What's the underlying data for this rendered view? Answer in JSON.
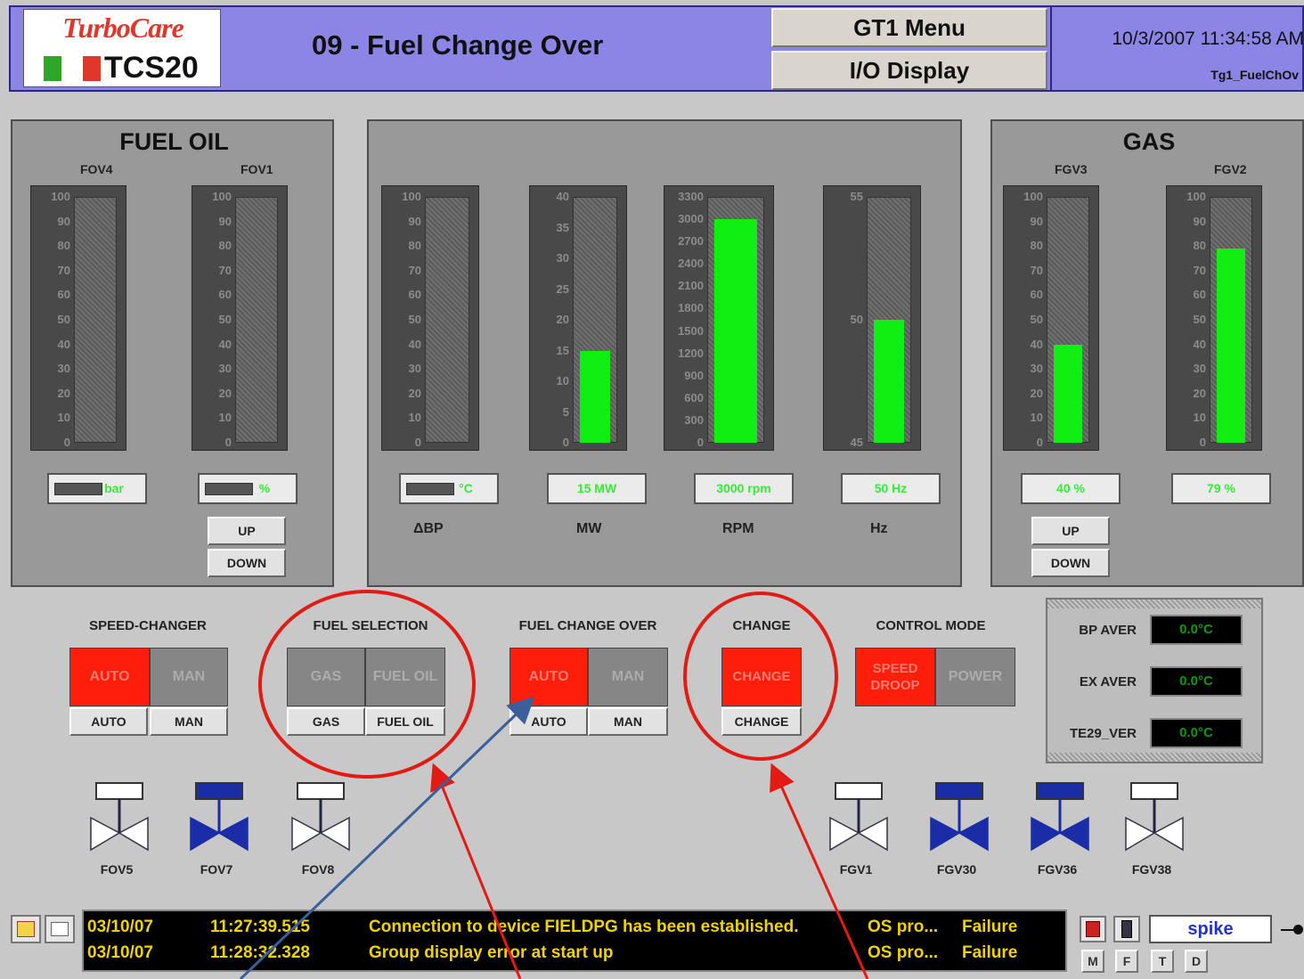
{
  "header": {
    "logo_brand": "TurboCare",
    "logo_model": "TCS20",
    "title": "09 - Fuel Change Over",
    "menu_button": "GT1 Menu",
    "io_button": "I/O Display",
    "datetime": "10/3/2007 11:34:58 AM",
    "screen_tag": "Tg1_FuelChOv"
  },
  "fuel_oil": {
    "title": "FUEL OIL",
    "gauges": [
      {
        "name": "FOV4",
        "ticks": [
          "100",
          "90",
          "80",
          "70",
          "60",
          "50",
          "40",
          "30",
          "20",
          "10",
          "0"
        ],
        "value": 0,
        "readout": "bar"
      },
      {
        "name": "FOV1",
        "ticks": [
          "100",
          "90",
          "80",
          "70",
          "60",
          "50",
          "40",
          "30",
          "20",
          "10",
          "0"
        ],
        "value": 0,
        "readout": "%"
      }
    ],
    "up_label": "UP",
    "down_label": "DOWN"
  },
  "center": {
    "gauges": [
      {
        "label": "ΔBP",
        "ticks": [
          "100",
          "90",
          "80",
          "70",
          "60",
          "50",
          "40",
          "30",
          "20",
          "10",
          "0"
        ],
        "value": 0,
        "readout": "°C"
      },
      {
        "label": "MW",
        "ticks": [
          "40",
          "35",
          "30",
          "25",
          "20",
          "15",
          "10",
          "5",
          "0"
        ],
        "value": 15,
        "max": 40,
        "readout": "15 MW"
      },
      {
        "label": "RPM",
        "ticks": [
          "3300",
          "3000",
          "2700",
          "2400",
          "2100",
          "1800",
          "1500",
          "1200",
          "900",
          "600",
          "300",
          "0"
        ],
        "value": 3000,
        "max": 3300,
        "readout": "3000 rpm"
      },
      {
        "label": "Hz",
        "ticks": [
          "55",
          "50",
          "45"
        ],
        "value": 50,
        "min": 45,
        "max": 55,
        "readout": "50 Hz"
      }
    ]
  },
  "gas": {
    "title": "GAS",
    "gauges": [
      {
        "name": "FGV3",
        "ticks": [
          "100",
          "90",
          "80",
          "70",
          "60",
          "50",
          "40",
          "30",
          "20",
          "10",
          "0"
        ],
        "value": 40,
        "readout": "40 %"
      },
      {
        "name": "FGV2",
        "ticks": [
          "100",
          "90",
          "80",
          "70",
          "60",
          "50",
          "40",
          "30",
          "20",
          "10",
          "0"
        ],
        "value": 79,
        "readout": "79 %"
      }
    ],
    "up_label": "UP",
    "down_label": "DOWN"
  },
  "controls": {
    "speed_changer": {
      "title": "SPEED-CHANGER",
      "tog_a": "AUTO",
      "tog_b": "MAN",
      "btn_a": "AUTO",
      "btn_b": "MAN"
    },
    "fuel_selection": {
      "title": "FUEL SELECTION",
      "tog_a": "GAS",
      "tog_b": "FUEL OIL",
      "btn_a": "GAS",
      "btn_b": "FUEL OIL"
    },
    "fuel_change_over": {
      "title": "FUEL CHANGE OVER",
      "tog_a": "AUTO",
      "tog_b": "MAN",
      "btn_a": "AUTO",
      "btn_b": "MAN"
    },
    "change": {
      "title": "CHANGE",
      "tog": "CHANGE",
      "btn": "CHANGE"
    },
    "control_mode": {
      "title": "CONTROL MODE",
      "tog_a": "SPEED DROOP",
      "tog_b": "POWER"
    }
  },
  "averages": [
    {
      "label": "BP AVER",
      "value": "0.0°C"
    },
    {
      "label": "EX AVER",
      "value": "0.0°C"
    },
    {
      "label": "TE29_VER",
      "value": "0.0°C"
    }
  ],
  "valves": [
    {
      "label": "FOV5",
      "state": "closed"
    },
    {
      "label": "FOV7",
      "state": "open"
    },
    {
      "label": "FOV8",
      "state": "closed"
    },
    {
      "label": "FGV1",
      "state": "closed"
    },
    {
      "label": "FGV30",
      "state": "open"
    },
    {
      "label": "FGV36",
      "state": "open"
    },
    {
      "label": "FGV38",
      "state": "closed"
    }
  ],
  "alarms": [
    {
      "date": "03/10/07",
      "time": "11:27:39.515",
      "message": "Connection to device FIELDPG has been established.",
      "source": "OS pro...",
      "status": "Failure"
    },
    {
      "date": "03/10/07",
      "time": "11:28:32.328",
      "message": "Group display error at start up",
      "source": "OS pro...",
      "status": "Failure"
    }
  ],
  "footer": {
    "user": "spike",
    "buttons": [
      "M",
      "F",
      "T",
      "D"
    ]
  },
  "colors": {
    "header_bg": "#8b86e6",
    "active_red": "#ff1e0c",
    "bar_green": "#11ee11",
    "alarm_yellow": "#f0d200",
    "annotation_red": "#e21b14",
    "annotation_blue": "#3a5f9a",
    "valve_blue": "#1a2da6"
  }
}
